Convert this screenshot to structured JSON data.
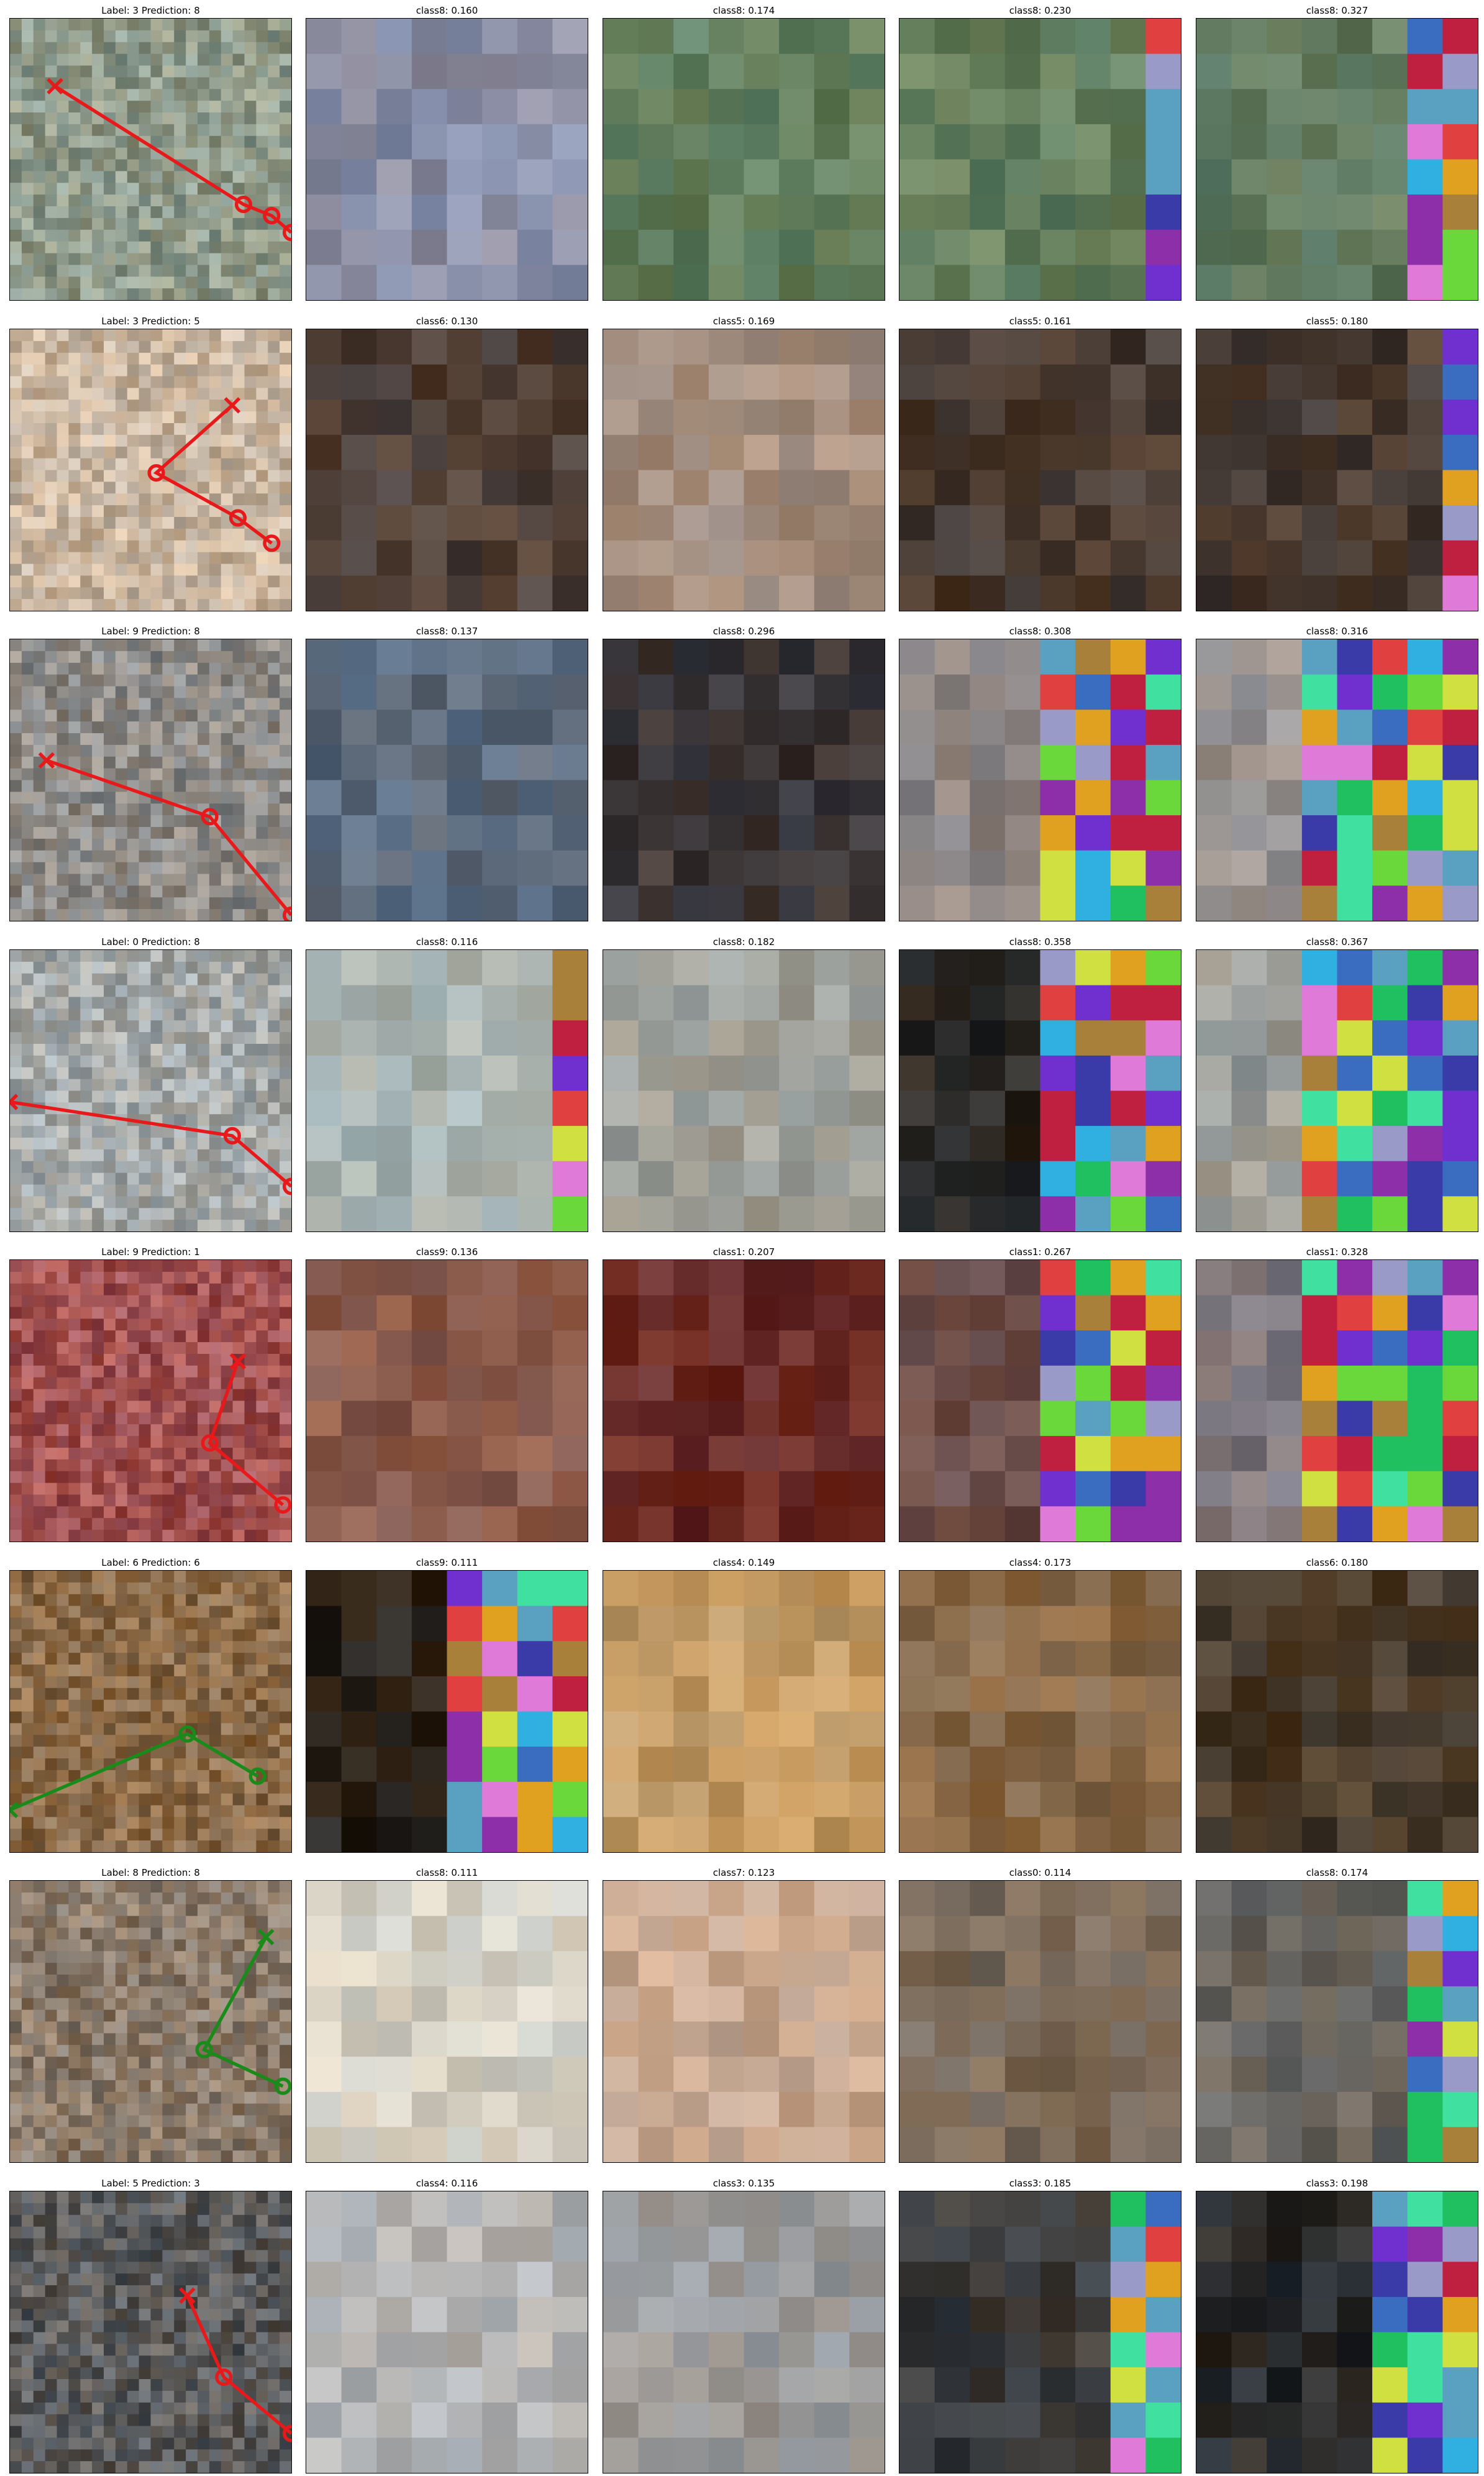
{
  "figure": {
    "rows": [
      {
        "titles": [
          "Label: 3 Prediction: 8",
          "class8: 0.160",
          "class8: 0.174",
          "class8: 0.230",
          "class8: 0.327"
        ],
        "base_colors": [
          "#8f9a8a",
          "#8a8fa6",
          "#64805f",
          "#658060",
          "#617a60"
        ],
        "path_color": "#e8191b",
        "path_points": [
          [
            0.16,
            0.24
          ],
          [
            0.83,
            0.66
          ],
          [
            0.93,
            0.7
          ],
          [
            1.0,
            0.76
          ]
        ],
        "patch_cols": [
          0,
          0,
          0,
          1,
          2
        ]
      },
      {
        "titles": [
          "Label: 3 Prediction: 5",
          "class6: 0.130",
          "class5: 0.169",
          "class5: 0.161",
          "class5: 0.180"
        ],
        "base_colors": [
          "#c8b5a0",
          "#4f4038",
          "#a48f80",
          "#4a3c33",
          "#4a3c33"
        ],
        "path_color": "#e8191b",
        "path_points": [
          [
            0.79,
            0.27
          ],
          [
            0.52,
            0.51
          ],
          [
            0.81,
            0.67
          ],
          [
            0.93,
            0.76
          ]
        ],
        "patch_cols": [
          0,
          0,
          0,
          0,
          1
        ]
      },
      {
        "titles": [
          "Label: 9 Prediction: 8",
          "class8: 0.137",
          "class8: 0.296",
          "class8: 0.308",
          "class8: 0.316"
        ],
        "base_colors": [
          "#8d8a86",
          "#5b6a7c",
          "#3b3638",
          "#8e8684",
          "#9a9492"
        ],
        "path_color": "#e8191b",
        "path_points": [
          [
            0.13,
            0.43
          ],
          [
            0.71,
            0.63
          ],
          [
            1.0,
            0.98
          ]
        ],
        "patch_cols": [
          0,
          0,
          0,
          4,
          5
        ]
      },
      {
        "titles": [
          "Label: 0 Prediction: 8",
          "class8: 0.116",
          "class8: 0.182",
          "class8: 0.358",
          "class8: 0.367"
        ],
        "base_colors": [
          "#a5a9a8",
          "#a9b3b0",
          "#9e9f98",
          "#2e2a26",
          "#9b9b95"
        ],
        "path_color": "#e8191b",
        "path_points": [
          [
            0.0,
            0.54
          ],
          [
            0.79,
            0.66
          ],
          [
            1.0,
            0.84
          ]
        ],
        "patch_cols": [
          0,
          1,
          0,
          4,
          5
        ]
      },
      {
        "titles": [
          "Label: 9 Prediction: 1",
          "class9: 0.136",
          "class1: 0.207",
          "class1: 0.267",
          "class1: 0.328"
        ],
        "base_colors": [
          "#a05050",
          "#8a5a4a",
          "#6a2a24",
          "#6a4a44",
          "#7d757a"
        ],
        "path_color": "#e8191b",
        "path_points": [
          [
            0.81,
            0.36
          ],
          [
            0.71,
            0.65
          ],
          [
            0.97,
            0.87
          ]
        ],
        "patch_cols": [
          0,
          0,
          0,
          4,
          5
        ]
      },
      {
        "titles": [
          "Label: 6 Prediction: 6",
          "class9: 0.111",
          "class4: 0.149",
          "class4: 0.173",
          "class6: 0.180"
        ],
        "base_colors": [
          "#8a6a48",
          "#2b2219",
          "#c29a64",
          "#8a6a48",
          "#4a3c2c"
        ],
        "path_color": "#1a8a1a",
        "path_points": [
          [
            0.0,
            0.85
          ],
          [
            0.63,
            0.58
          ],
          [
            0.88,
            0.73
          ]
        ],
        "patch_cols": [
          0,
          4,
          0,
          0,
          0
        ]
      },
      {
        "titles": [
          "Label: 8 Prediction: 8",
          "class8: 0.111",
          "class7: 0.123",
          "class0: 0.114",
          "class8: 0.174"
        ],
        "base_colors": [
          "#8a7a6a",
          "#d4d0c4",
          "#c8a890",
          "#7a6a5a",
          "#6a6660"
        ],
        "path_color": "#1a8a1a",
        "path_points": [
          [
            0.91,
            0.2
          ],
          [
            0.69,
            0.6
          ],
          [
            0.97,
            0.73
          ]
        ],
        "patch_cols": [
          0,
          0,
          0,
          0,
          2
        ]
      },
      {
        "titles": [
          "Label: 5 Prediction: 3",
          "class4: 0.116",
          "class3: 0.135",
          "class3: 0.185",
          "class3: 0.198"
        ],
        "base_colors": [
          "#5a5a5a",
          "#b4b4b4",
          "#9a9a9a",
          "#3a3a3a",
          "#2a2a2a"
        ],
        "path_color": "#e8191b",
        "path_points": [
          [
            0.63,
            0.37
          ],
          [
            0.76,
            0.66
          ],
          [
            1.0,
            0.86
          ]
        ],
        "patch_cols": [
          0,
          0,
          0,
          2,
          3
        ]
      }
    ],
    "patch_palette": [
      "#8c2fa8",
      "#5aa0c0",
      "#e07ad8",
      "#3a6cc0",
      "#6ad83a",
      "#3a3aa8",
      "#a8803a",
      "#9a9ac8",
      "#20c060",
      "#e0a020",
      "#c02040",
      "#40e0a0",
      "#e04040",
      "#7030d0",
      "#30b0e0",
      "#d0e040"
    ]
  }
}
